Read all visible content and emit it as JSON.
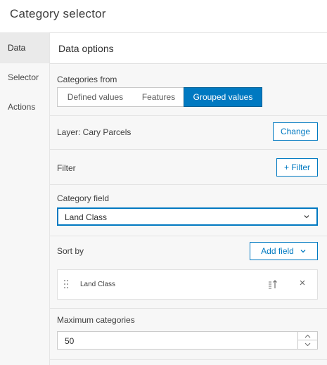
{
  "page": {
    "title": "Category selector"
  },
  "sidebar": {
    "items": [
      {
        "label": "Data",
        "active": true
      },
      {
        "label": "Selector",
        "active": false
      },
      {
        "label": "Actions",
        "active": false
      }
    ]
  },
  "panel": {
    "header": "Data options",
    "categories_from": {
      "label": "Categories from",
      "options": [
        "Defined values",
        "Features",
        "Grouped values"
      ],
      "selected": "Grouped values"
    },
    "layer": {
      "label": "Layer: Cary Parcels",
      "button": "Change"
    },
    "filter": {
      "label": "Filter",
      "button": "+ Filter"
    },
    "category_field": {
      "label": "Category field",
      "value": "Land Class"
    },
    "sort_by": {
      "label": "Sort by",
      "add_button": "Add field",
      "fields": [
        {
          "name": "Land Class"
        }
      ]
    },
    "max_categories": {
      "label": "Maximum categories",
      "value": "50"
    }
  },
  "colors": {
    "accent": "#0079c1",
    "panel_bg": "#f7f7f7",
    "border": "#c9c9c9"
  },
  "icons": [
    "chevron-down-icon",
    "grip-icon",
    "sort-ascending-icon",
    "close-icon",
    "chevron-up-icon"
  ]
}
